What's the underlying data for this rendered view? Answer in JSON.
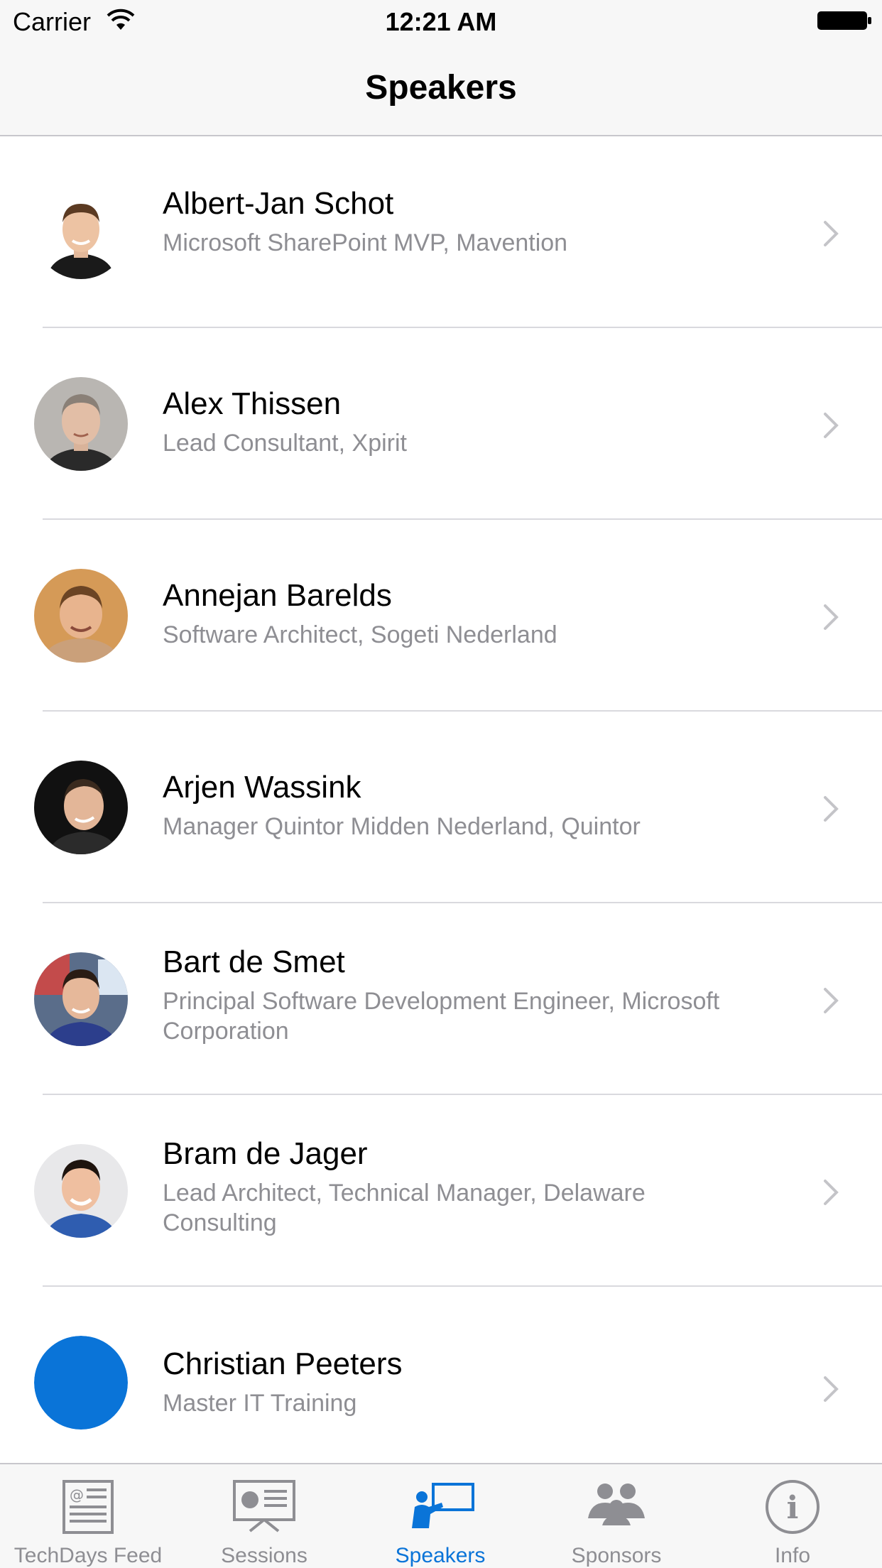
{
  "status_bar": {
    "carrier": "Carrier",
    "time": "12:21 AM"
  },
  "nav": {
    "title": "Speakers"
  },
  "speakers": [
    {
      "name": "Albert-Jan  Schot",
      "title": "Microsoft SharePoint MVP, Mavention"
    },
    {
      "name": "Alex Thissen",
      "title": "Lead Consultant, Xpirit"
    },
    {
      "name": "Annejan  Barelds",
      "title": "Software Architect, Sogeti Nederland"
    },
    {
      "name": "Arjen  Wassink",
      "title": "Manager Quintor Midden Nederland, Quintor"
    },
    {
      "name": "Bart de Smet",
      "title": "Principal Software Development Engineer, Microsoft Corporation"
    },
    {
      "name": "Bram  de Jager",
      "title": "Lead Architect, Technical Manager, Delaware Consulting"
    },
    {
      "name": "Christian  Peeters",
      "title": "Master IT Training"
    }
  ],
  "tabs": [
    {
      "label": "TechDays Feed",
      "icon": "newspaper-icon"
    },
    {
      "label": "Sessions",
      "icon": "presentation-board-icon"
    },
    {
      "label": "Speakers",
      "icon": "speaker-presenting-icon",
      "active": true
    },
    {
      "label": "Sponsors",
      "icon": "group-people-icon"
    },
    {
      "label": "Info",
      "icon": "info-icon"
    }
  ],
  "colors": {
    "accent": "#0a74d8",
    "inactive_tab": "#8e8e93",
    "subtitle": "#8e8e93",
    "placeholder_avatar": "#0a74d8"
  }
}
